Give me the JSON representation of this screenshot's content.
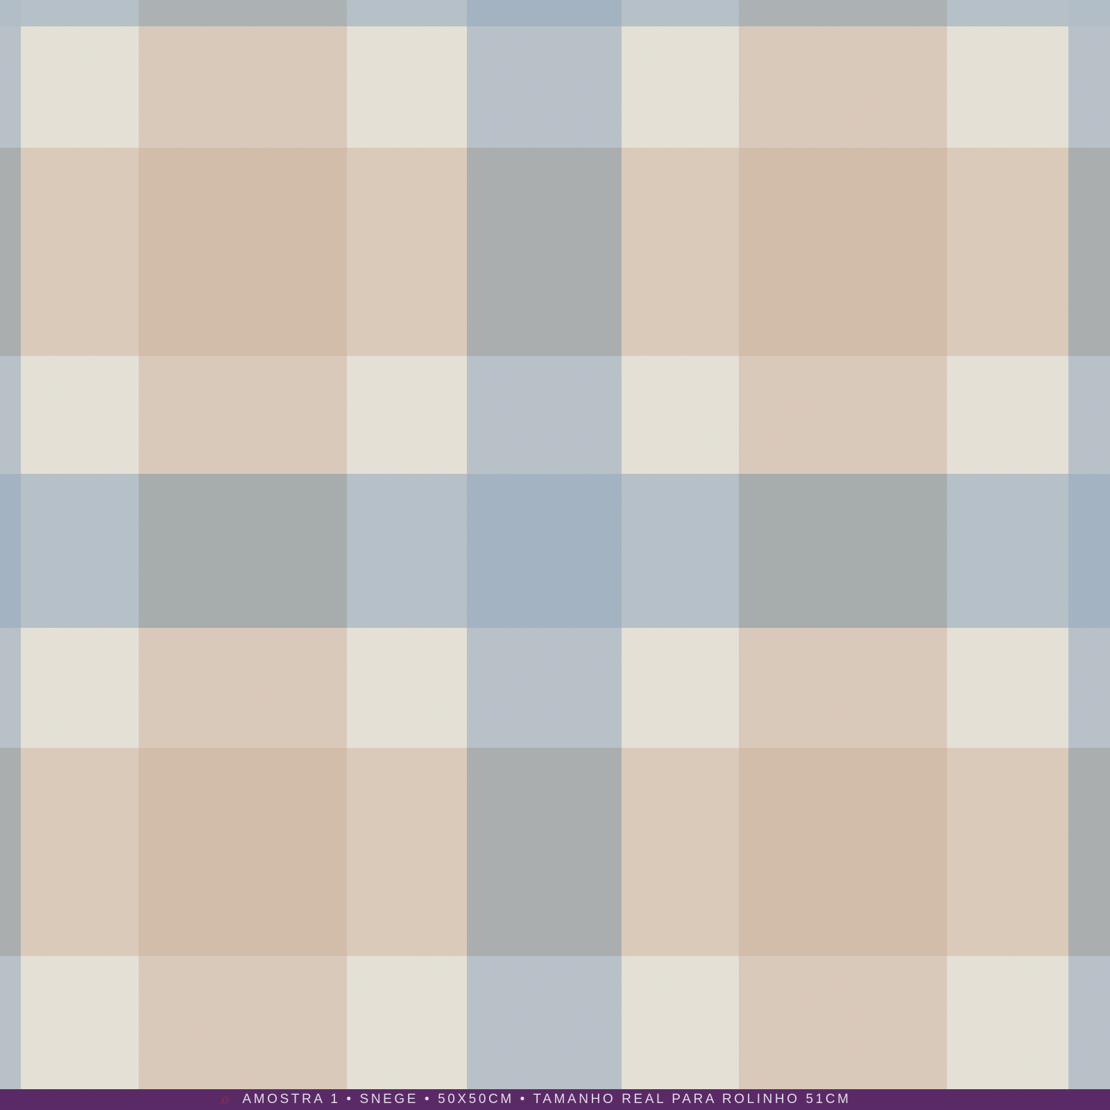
{
  "caption": {
    "text": "AMOSTRA 1 • SNEGE • 50X50CM • TAMANHO REAL PARA ROLINHO 51CM",
    "bar_color": "#5a2a66",
    "text_color": "#e4dceb"
  },
  "logo": {
    "icon": "brand-logo-icon",
    "color": "#a0244a"
  },
  "pattern": {
    "name": "gingham-check",
    "colors": {
      "cream": "#e6e2d7",
      "tan": "#dccabb",
      "tan_dark": "#cfb9a6",
      "blue": "#b3bec8",
      "blue_dark": "#a9adae",
      "gray": "#a6acac"
    }
  }
}
